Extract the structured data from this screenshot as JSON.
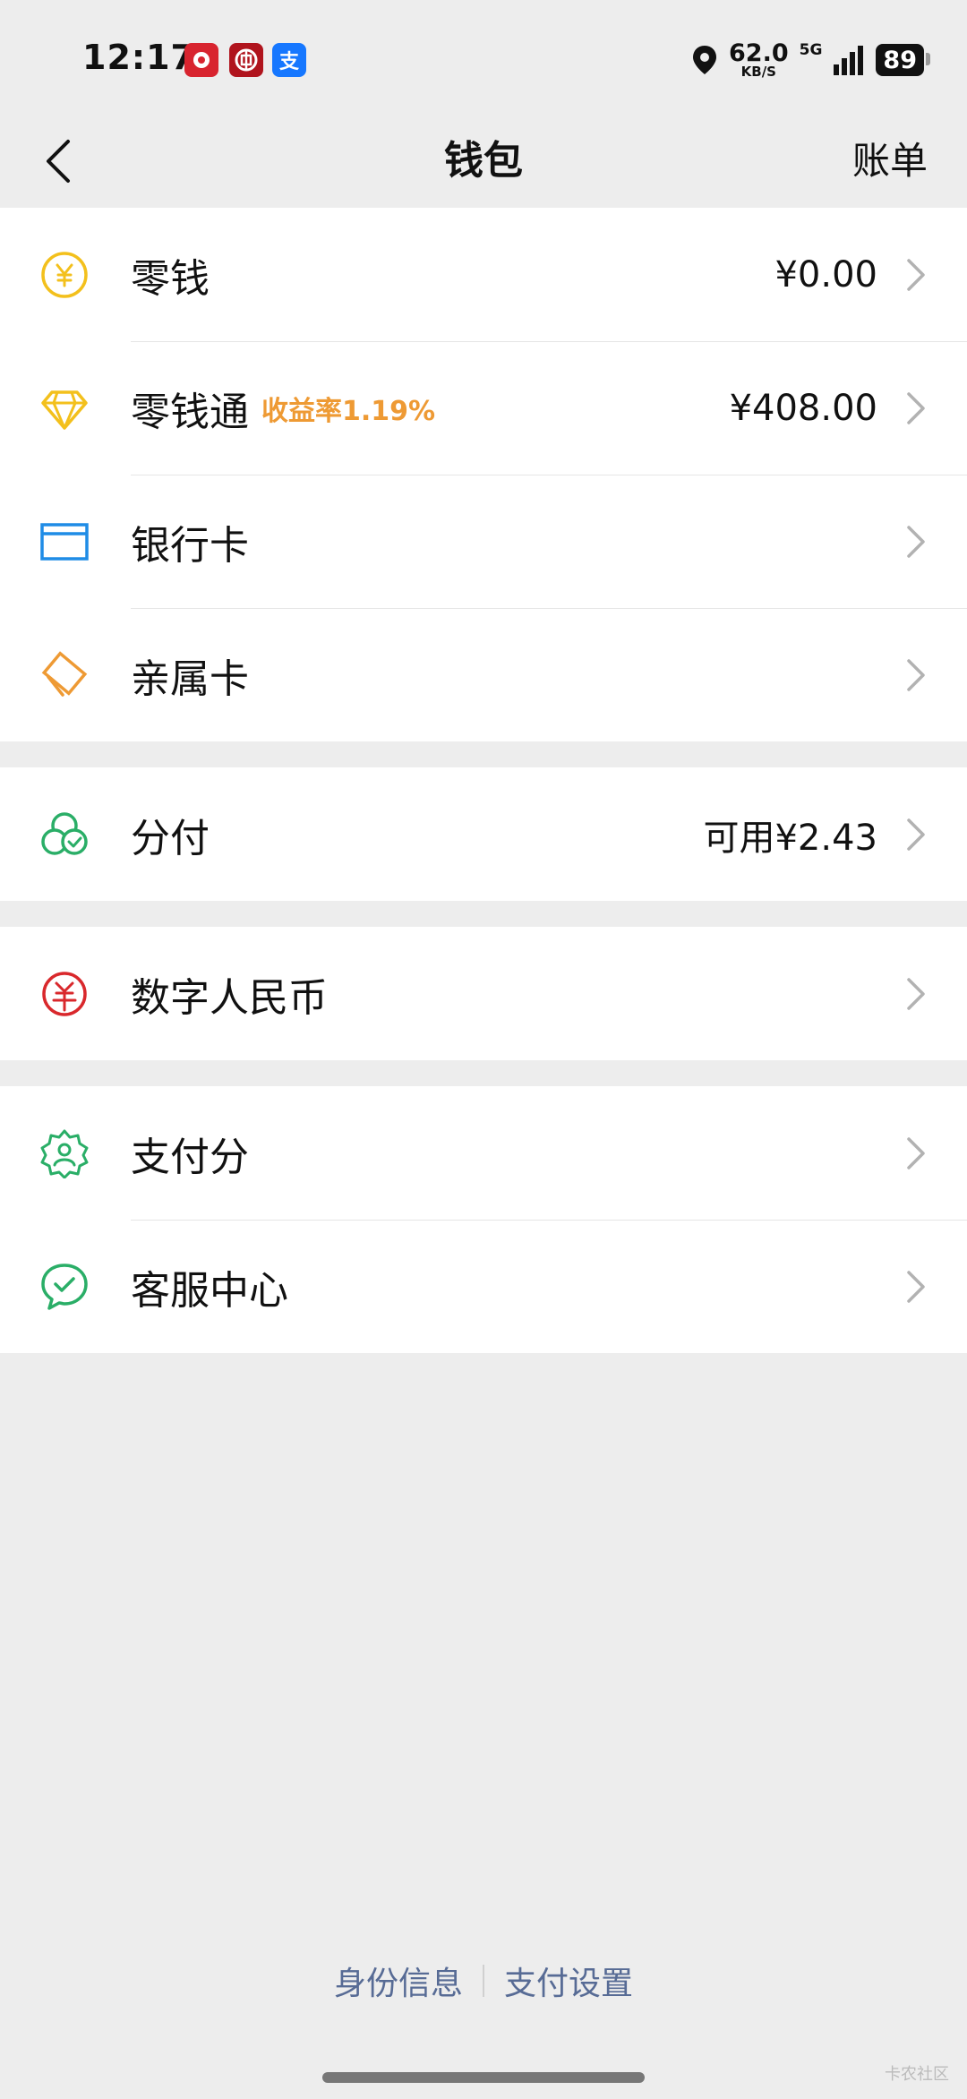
{
  "status": {
    "time": "12:17",
    "net_speed": "62.0",
    "net_unit": "KB/S",
    "network": "5G",
    "battery": "89",
    "apps": [
      "app-red-icon",
      "bank-icon",
      "alipay-icon"
    ],
    "alipay_char": "支"
  },
  "nav": {
    "title": "钱包",
    "bill": "账单"
  },
  "group1": [
    {
      "label": "零钱",
      "value": "¥0.00",
      "icon": "yuan-coin-icon"
    },
    {
      "label": "零钱通",
      "badge": "收益率1.19%",
      "value": "¥408.00",
      "icon": "diamond-icon"
    },
    {
      "label": "银行卡",
      "icon": "bank-card-icon"
    },
    {
      "label": "亲属卡",
      "icon": "family-card-icon"
    }
  ],
  "group2": [
    {
      "label": "分付",
      "value": "可用¥2.43",
      "icon": "fenfu-icon"
    }
  ],
  "group3": [
    {
      "label": "数字人民币",
      "icon": "digital-rmb-icon"
    }
  ],
  "group4": [
    {
      "label": "支付分",
      "icon": "payscore-icon"
    },
    {
      "label": "客服中心",
      "icon": "customer-service-icon"
    }
  ],
  "footer": {
    "identity": "身份信息",
    "settings": "支付设置"
  },
  "watermark": "卡农社区",
  "colors": {
    "background": "#ededed",
    "gold": "#f3c01c",
    "blue": "#1f8ce6",
    "orange": "#ee9a34",
    "green": "#2aae67",
    "red": "#d9282c",
    "link": "#576b95"
  }
}
